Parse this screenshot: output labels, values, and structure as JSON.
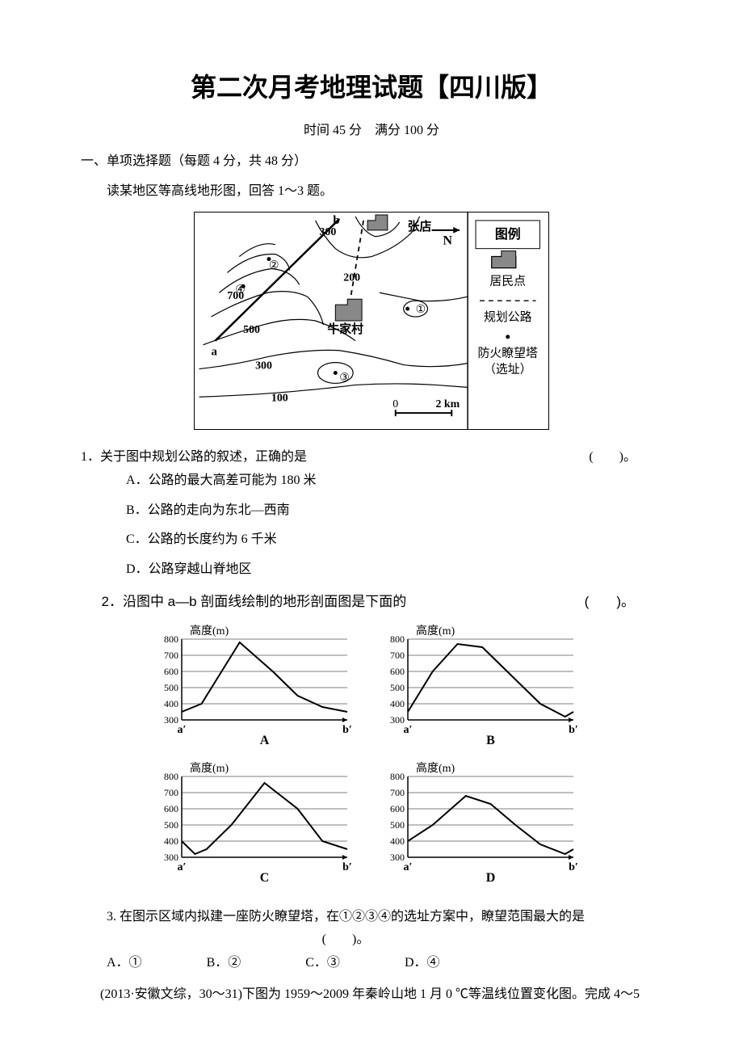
{
  "title": "第二次月考地理试题【四川版】",
  "subtitle": "时间 45 分　满分 100 分",
  "section1": "一、单项选择题（每题 4 分，共 48 分）",
  "instruction1": "读某地区等高线地形图，回答 1～3 题。",
  "map": {
    "labels": {
      "b": "b",
      "a": "a",
      "val300_top": "300",
      "val200": "200",
      "val700": "700",
      "val500": "500",
      "val300_bot": "300",
      "val100": "100",
      "zhangdian": "张店",
      "niujiacun": "牛家村",
      "N": "N",
      "c1": "①",
      "c2": "②",
      "c3": "③",
      "c4": "④",
      "scale_0": "0",
      "scale_2km": "2 km"
    },
    "legend": {
      "title": "图例",
      "settlement": "居民点",
      "road": "规划公路",
      "tower": "防火瞭望塔",
      "tower2": "（选址）"
    }
  },
  "q1": {
    "text": "1．关于图中规划公路的叙述，正确的是",
    "blank": "(　　)。",
    "A": "A．公路的最大高差可能为 180 米",
    "B": "B．公路的走向为东北—西南",
    "C": "C．公路的长度约为 6 千米",
    "D": "D．公路穿越山脊地区"
  },
  "q2": {
    "text": "2．沿图中 a—b 剖面线绘制的地形剖面图是下面的",
    "blank": "(　　)。"
  },
  "chart_data": [
    {
      "type": "line",
      "label": "A",
      "xlabel_left": "a′",
      "xlabel_right": "b′",
      "ylabel": "高度(m)",
      "ylim": [
        300,
        800
      ],
      "yticks": [
        300,
        400,
        500,
        600,
        700,
        800
      ],
      "x": [
        0,
        0.12,
        0.35,
        0.55,
        0.7,
        0.85,
        1.0
      ],
      "values": [
        350,
        400,
        780,
        600,
        450,
        380,
        350
      ]
    },
    {
      "type": "line",
      "label": "B",
      "xlabel_left": "a′",
      "xlabel_right": "b′",
      "ylabel": "高度(m)",
      "ylim": [
        300,
        800
      ],
      "yticks": [
        300,
        400,
        500,
        600,
        700,
        800
      ],
      "x": [
        0,
        0.15,
        0.3,
        0.45,
        0.6,
        0.8,
        0.95,
        1.0
      ],
      "values": [
        350,
        600,
        770,
        750,
        600,
        400,
        320,
        350
      ]
    },
    {
      "type": "line",
      "label": "C",
      "xlabel_left": "a′",
      "xlabel_right": "b′",
      "ylabel": "高度(m)",
      "ylim": [
        300,
        800
      ],
      "yticks": [
        300,
        400,
        500,
        600,
        700,
        800
      ],
      "x": [
        0,
        0.08,
        0.15,
        0.3,
        0.5,
        0.7,
        0.85,
        1.0
      ],
      "values": [
        400,
        320,
        350,
        500,
        760,
        600,
        400,
        350
      ]
    },
    {
      "type": "line",
      "label": "D",
      "xlabel_left": "a′",
      "xlabel_right": "b′",
      "ylabel": "高度(m)",
      "ylim": [
        300,
        800
      ],
      "yticks": [
        300,
        400,
        500,
        600,
        700,
        800
      ],
      "x": [
        0,
        0.15,
        0.35,
        0.5,
        0.65,
        0.8,
        0.95,
        1.0
      ],
      "values": [
        400,
        500,
        680,
        630,
        500,
        380,
        320,
        350
      ]
    }
  ],
  "q3": {
    "text": "3. 在图示区域内拟建一座防火瞭望塔，在①②③④的选址方案中，瞭望范围最大的是",
    "blank": "(　　)。",
    "A": "A．①",
    "B": "B．②",
    "C": "C．③",
    "D": "D．④"
  },
  "citation": "(2013·安徽文综，30～31)下图为 1959～2009 年秦岭山地 1 月 0 ℃等温线位置变化图。完成 4～5"
}
